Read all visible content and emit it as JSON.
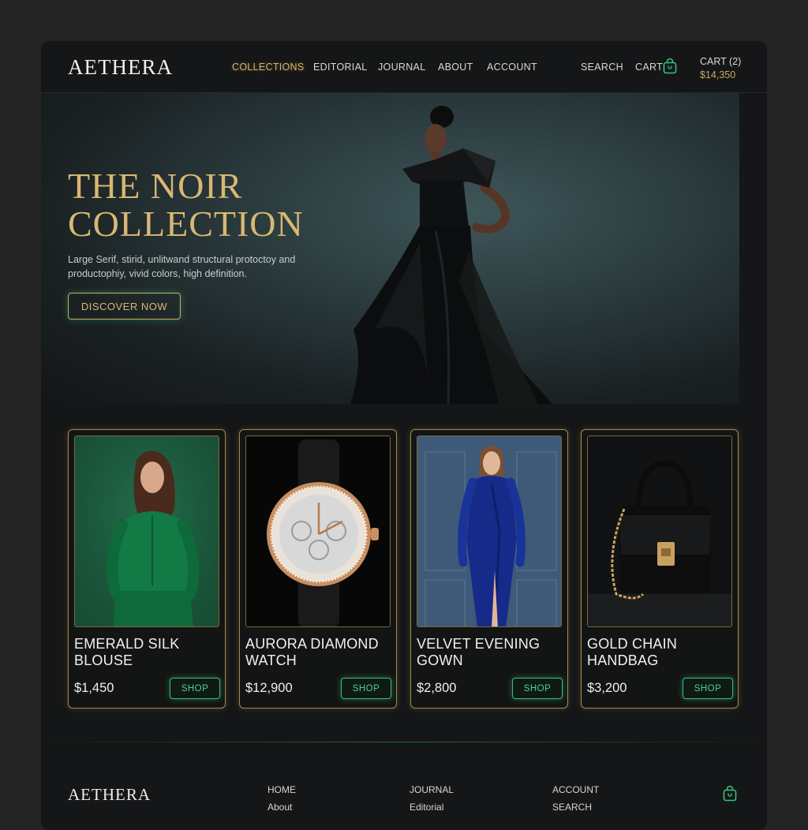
{
  "brand": {
    "logo": "AETHERA"
  },
  "nav": {
    "items": [
      {
        "label": "COLLECTIONS",
        "active": true
      },
      {
        "label": "EDITORIAL",
        "active": false
      },
      {
        "label": "JOURNAL",
        "active": false
      },
      {
        "label": "ABOUT",
        "active": false
      },
      {
        "label": "ACCOUNT",
        "active": false
      }
    ],
    "search_label": "SEARCH",
    "cart_label": "CART",
    "cart_icon": "shopping-bag-icon",
    "cart_count": "CART (2)",
    "cart_total": "$14,350"
  },
  "hero": {
    "title": "THE NOIR\nCOLLECTION",
    "subtitle": "Large Serif, stirid, unlitwand structural protoctoy and productophiy, vivid colors, high definition.",
    "cta_label": "DISCOVER NOW"
  },
  "products": [
    {
      "name": "EMERALD SILK BLOUSE",
      "price": "$1,450",
      "button": "SHOP"
    },
    {
      "name": "AURORA DIAMOND WATCH",
      "price": "$12,900",
      "button": "SHOP"
    },
    {
      "name": "VELVET EVENING GOWN",
      "price": "$2,800",
      "button": "SHOP"
    },
    {
      "name": "GOLD CHAIN HANDBAG",
      "price": "$3,200",
      "button": "SHOP"
    }
  ],
  "footer": {
    "logo": "AETHERA",
    "columns": [
      [
        "HOME",
        "About"
      ],
      [
        "JOURNAL",
        "Editorial"
      ],
      [
        "ACCOUNT",
        "SEARCH"
      ]
    ],
    "bag_icon": "shopping-bag-icon"
  },
  "colors": {
    "accent_gold": "#d9b872",
    "accent_green": "#36c27a",
    "background": "#151617",
    "hero_teal": "#3e5659"
  }
}
